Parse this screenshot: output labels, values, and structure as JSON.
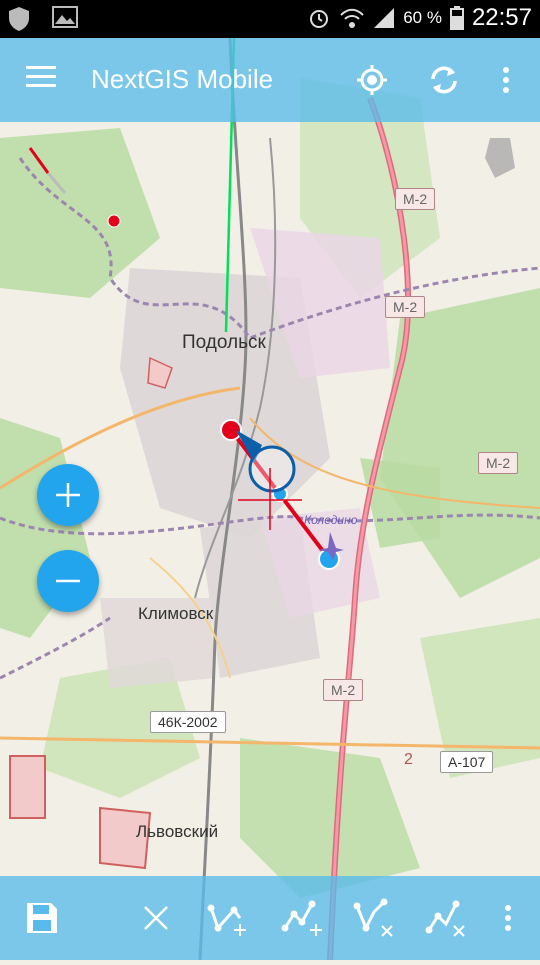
{
  "statusbar": {
    "battery": "60 %",
    "time": "22:57"
  },
  "appbar": {
    "title": "NextGIS Mobile"
  },
  "map": {
    "labels": {
      "podolsk": "Подольск",
      "klimovsk": "Климовск",
      "lvovsky": "Львовский",
      "koledino": "Коледино"
    },
    "road_shields": {
      "m2_a": "М-2",
      "m2_b": "М-2",
      "m2_c": "М-2",
      "m2_d": "М-2",
      "k46": "46К-2002",
      "a107": "А-107",
      "two": "2"
    }
  },
  "icons": {
    "menu": "menu-icon",
    "locate": "my-location-icon",
    "sync": "sync-icon",
    "overflow": "more-vert-icon",
    "zoom_in": "plus-icon",
    "zoom_out": "minus-icon",
    "save": "save-icon",
    "cancel": "close-icon",
    "add_point": "add-vertex-icon",
    "add_point_gps": "add-vertex-gps-icon",
    "delete_point": "delete-vertex-icon",
    "delete_line": "delete-line-icon"
  },
  "colors": {
    "bar": "#59bbeb",
    "fab": "#23a5ee",
    "edit_line": "#e3001b",
    "track": "#00e05a"
  }
}
